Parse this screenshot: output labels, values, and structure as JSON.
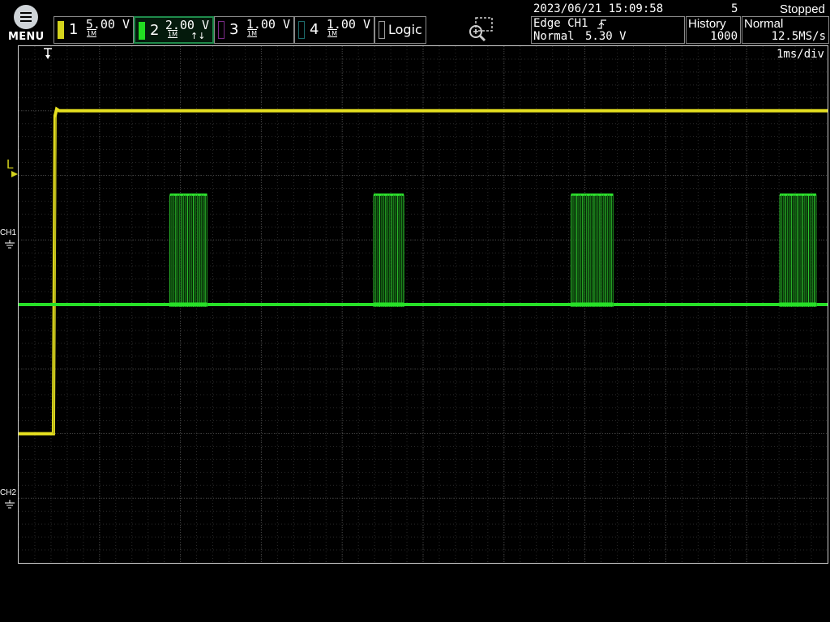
{
  "menu": {
    "label": "MENU",
    "icon": "menu-icon"
  },
  "channels": [
    {
      "num": "1",
      "volts": "5.00 V",
      "coupling": "1M",
      "color": "#d4d31c",
      "active": false
    },
    {
      "num": "2",
      "volts": "2.00 V",
      "coupling": "1M",
      "color": "#22dd22",
      "active": true,
      "filter": "↑↓"
    },
    {
      "num": "3",
      "volts": "1.00 V",
      "coupling": "1M",
      "color": "#7a2b87",
      "active": false
    },
    {
      "num": "4",
      "volts": "1.00 V",
      "coupling": "1M",
      "color": "#1d6a6a",
      "active": false
    }
  ],
  "logic": {
    "label": "Logic",
    "color": "#9a9a9a"
  },
  "zoom": {
    "icon": "zoom-icon"
  },
  "status": {
    "datetime": "2023/06/21 15:09:58",
    "count": "5",
    "state": "Stopped"
  },
  "trigger": {
    "type": "Edge CH1",
    "slope_icon": "rising-edge-icon",
    "mode": "Normal",
    "level": "5.30 V"
  },
  "history": {
    "label": "History",
    "value": "1000"
  },
  "acquisition": {
    "mode": "Normal",
    "rate": "12.5MS/s"
  },
  "timebase": "1ms/div",
  "markers": {
    "ch1_label": "CH1",
    "ch2_label": "CH2",
    "trigger_level_label": "L"
  },
  "waveforms": {
    "ch1": {
      "low_level_div": -2.0,
      "high_level_div": 3.0,
      "edge_time_div": 0.45
    },
    "ch2": {
      "low_level_div": 0.0,
      "high_level_div": 1.7,
      "bursts": [
        [
          1.87,
          2.33
        ],
        [
          4.39,
          4.76
        ],
        [
          6.83,
          7.35
        ],
        [
          9.41,
          9.86
        ]
      ]
    }
  }
}
